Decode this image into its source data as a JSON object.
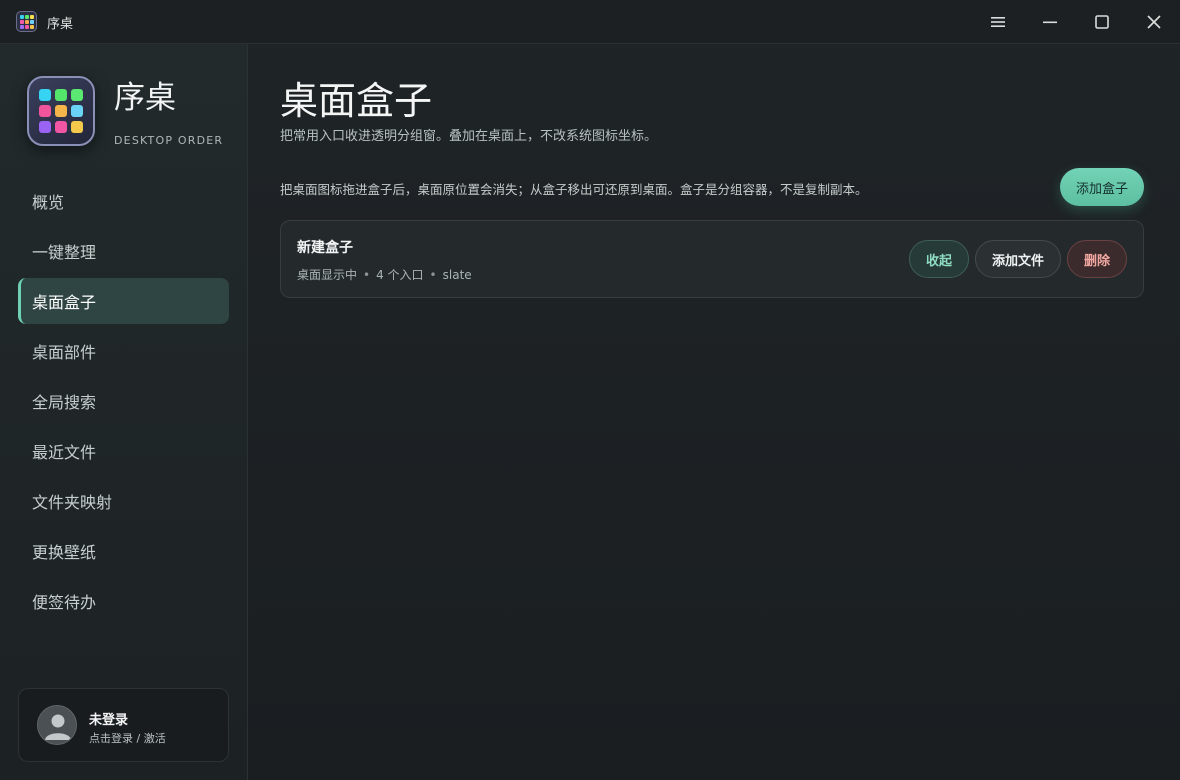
{
  "window": {
    "title": "序桌"
  },
  "sidebar": {
    "brand_name": "序桌",
    "brand_sub": "DESKTOP ORDER",
    "items": [
      {
        "label": "概览",
        "active": false
      },
      {
        "label": "一键整理",
        "active": false
      },
      {
        "label": "桌面盒子",
        "active": true
      },
      {
        "label": "桌面部件",
        "active": false
      },
      {
        "label": "全局搜索",
        "active": false
      },
      {
        "label": "最近文件",
        "active": false
      },
      {
        "label": "文件夹映射",
        "active": false
      },
      {
        "label": "更换壁纸",
        "active": false
      },
      {
        "label": "便签待办",
        "active": false
      }
    ],
    "user": {
      "name": "未登录",
      "sub": "点击登录 / 激活"
    }
  },
  "main": {
    "title": "桌面盒子",
    "subtitle": "把常用入口收进透明分组窗。叠加在桌面上，不改系统图标坐标。",
    "info": "把桌面图标拖进盒子后，桌面原位置会消失；从盒子移出可还原到桌面。盒子是分组容器，不是复制副本。",
    "add_box_label": "添加盒子",
    "boxes": [
      {
        "name": "新建盒子",
        "status": "桌面显示中",
        "count": "4 个入口",
        "theme": "slate",
        "collapse_label": "收起",
        "add_file_label": "添加文件",
        "delete_label": "删除"
      }
    ]
  },
  "colors": {
    "accent": "#6fd1b3",
    "danger": "#f1a7a2",
    "background": "#1b1f22"
  }
}
